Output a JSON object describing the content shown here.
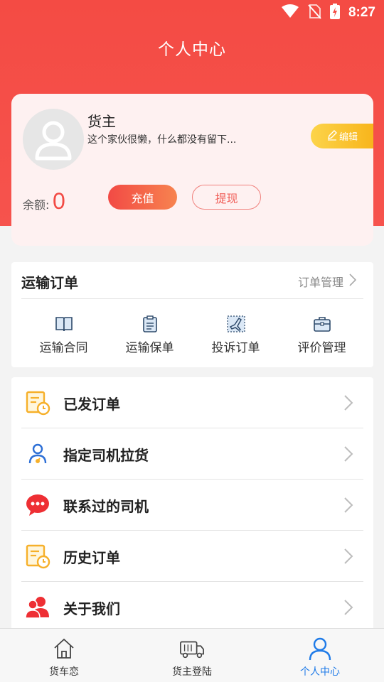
{
  "status_bar": {
    "time": "8:27"
  },
  "header": {
    "title": "个人中心"
  },
  "profile": {
    "name": "货主",
    "signature": "这个家伙很懒，什么都没有留下...",
    "edit_label": "编辑",
    "balance_label": "余额:",
    "balance_value": "0",
    "recharge_label": "充值",
    "withdraw_label": "提现"
  },
  "orders": {
    "title": "运输订单",
    "manage_label": "订单管理",
    "items": [
      {
        "label": "运输合同",
        "icon": "book-icon"
      },
      {
        "label": "运输保单",
        "icon": "clipboard-icon"
      },
      {
        "label": "投诉订单",
        "icon": "plane-icon"
      },
      {
        "label": "评价管理",
        "icon": "briefcase-icon"
      }
    ]
  },
  "menu": [
    {
      "label": "已发订单",
      "icon": "order-clock-icon"
    },
    {
      "label": "指定司机拉货",
      "icon": "driver-icon"
    },
    {
      "label": "联系过的司机",
      "icon": "chat-bubble-icon"
    },
    {
      "label": "历史订单",
      "icon": "history-order-icon"
    },
    {
      "label": "关于我们",
      "icon": "users-icon"
    }
  ],
  "tabbar": [
    {
      "label": "货车恋",
      "icon": "home-icon",
      "active": false
    },
    {
      "label": "货主登陆",
      "icon": "truck-icon",
      "active": false
    },
    {
      "label": "个人中心",
      "icon": "person-icon",
      "active": true
    }
  ],
  "colors": {
    "primary": "#f44b44",
    "accent_yellow": "#f8b51c",
    "tab_active": "#1f7be8"
  }
}
